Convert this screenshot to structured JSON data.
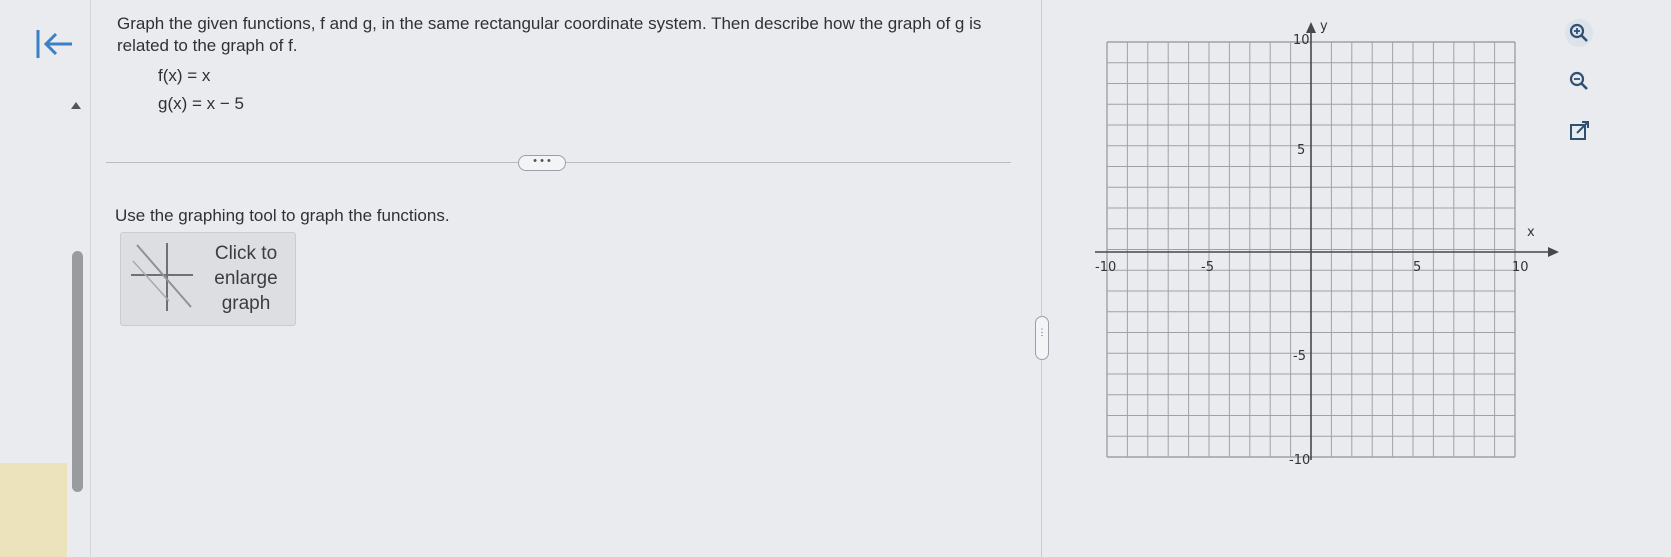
{
  "question": {
    "prompt": "Graph the given functions, f and g, in the same rectangular coordinate system. Then describe how the graph of g is related to the graph of f.",
    "f_eq": "f(x) = x",
    "g_eq": "g(x) = x − 5"
  },
  "expand_label": "• • •",
  "instruction": "Use the graphing tool to graph the functions.",
  "graph_button": {
    "line1": "Click to",
    "line2": "enlarge",
    "line3": "graph"
  },
  "graph": {
    "x_axis_label": "x",
    "y_axis_label": "y",
    "x_range": [
      -10,
      10
    ],
    "y_range": [
      -10,
      10
    ],
    "ticks": {
      "x_neg10": "-10",
      "x_neg5": "-5",
      "x_5": "5",
      "x_10": "10",
      "y_10": "10",
      "y_5": "5",
      "y_neg5": "-5",
      "y_neg10": "-10"
    }
  },
  "colors": {
    "accent": "#3b7fc4",
    "grid": "#9ea2a8"
  },
  "icons": [
    "back-arrow-icon",
    "zoom-in-icon",
    "zoom-out-icon",
    "popout-icon"
  ]
}
